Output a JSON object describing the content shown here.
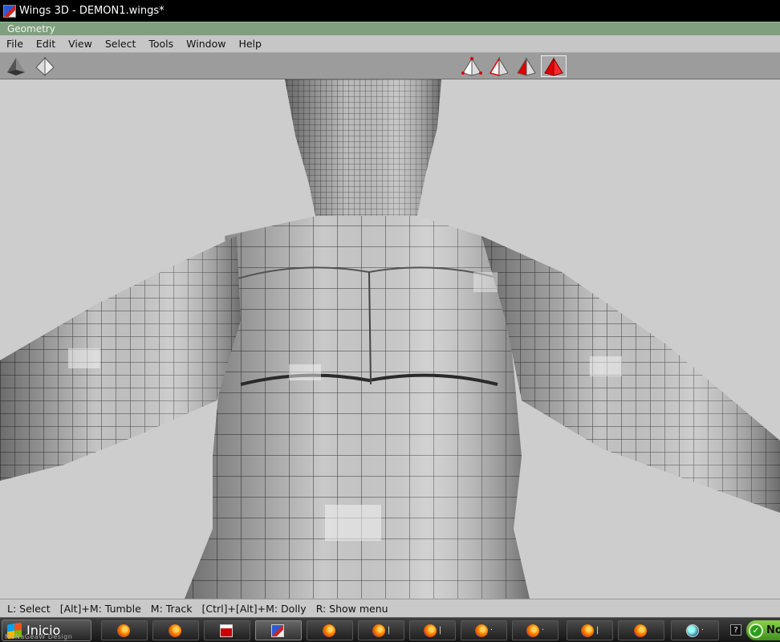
{
  "window": {
    "title": "Wings 3D - DEMON1.wings*",
    "mode_label": "Geometry"
  },
  "menubar": {
    "items": [
      "File",
      "Edit",
      "View",
      "Select",
      "Tools",
      "Window",
      "Help"
    ]
  },
  "toolbar": {
    "left_buttons": [
      {
        "name": "smooth-shade-icon"
      },
      {
        "name": "flat-shade-icon"
      }
    ],
    "selection_modes": [
      {
        "name": "vertex-select-icon",
        "active": false
      },
      {
        "name": "edge-select-icon",
        "active": false
      },
      {
        "name": "face-select-icon",
        "active": false
      },
      {
        "name": "body-select-icon",
        "active": true
      }
    ],
    "accent_color": "#e00000"
  },
  "viewport": {
    "background_color": "#cdcdcd",
    "content": "demon-mesh-model"
  },
  "statusbar": {
    "hints": [
      "L: Select",
      "[Alt]+M: Tumble",
      "M: Track",
      "[Ctrl]+[Alt]+M: Dolly",
      "R: Show menu"
    ]
  },
  "taskbar": {
    "start_label": "Inicio",
    "start_sub": "MeNaGeaW Design",
    "tasks": [
      {
        "icon": "firefox-icon",
        "label": ""
      },
      {
        "icon": "firefox-icon",
        "label": ""
      },
      {
        "icon": "app-red-icon",
        "label": ""
      },
      {
        "icon": "wings-icon",
        "label": "",
        "active": true
      },
      {
        "icon": "firefox-icon",
        "label": ""
      },
      {
        "icon": "firefox-icon",
        "label": "|"
      },
      {
        "icon": "firefox-icon",
        "label": "|"
      },
      {
        "icon": "firefox-icon",
        "label": "·"
      },
      {
        "icon": "firefox-icon",
        "label": "·"
      },
      {
        "icon": "firefox-icon",
        "label": "|"
      },
      {
        "icon": "firefox-icon",
        "label": ""
      },
      {
        "icon": "globe-icon",
        "label": "·"
      }
    ],
    "help_label": "?",
    "tray_label": "No"
  }
}
